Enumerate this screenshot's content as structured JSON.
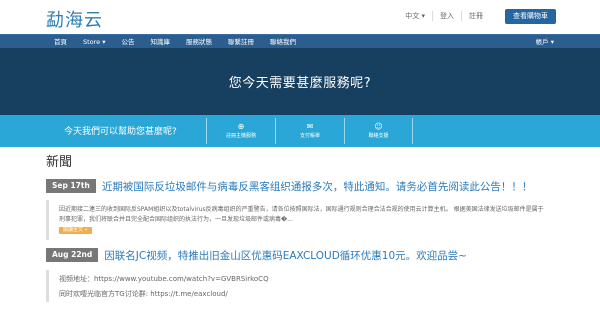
{
  "header": {
    "logo": "勐海云",
    "links": [
      "中文 ▾",
      "登入",
      "註冊"
    ],
    "cart_button": "查看購物車"
  },
  "nav": {
    "items": [
      "首頁",
      "Store ▾",
      "公告",
      "知識庫",
      "服務狀態",
      "聯繫註冊",
      "聯絡我們"
    ],
    "account": "帳戶 ▾"
  },
  "hero": {
    "title": "您今天需要甚麼服務呢?"
  },
  "helpbar": {
    "text": "今天我們可以幫助您甚麼呢?",
    "options": [
      {
        "icon": "globe-icon",
        "glyph": "⊕",
        "label": "註冊主機服務"
      },
      {
        "icon": "ticket-icon",
        "glyph": "✉",
        "label": "支付帳單"
      },
      {
        "icon": "support-icon",
        "glyph": "☺",
        "label": "聯絡支援"
      }
    ]
  },
  "news": {
    "section_title": "新聞",
    "items": [
      {
        "date": "Sep 17th",
        "title": "近期被国际反垃圾邮件与病毒反黑客组织通报多次，特此通知。请务必首先阅读此公告！！！",
        "body": "因近期接二連三的收到国际反SPAM組织以及totalvirus反病毒组织的严重警告，请各位按照国际法，国际通行规则合理合法合规的使用云计算主机。 根据美国法律发送垃圾邮件是属于刑事犯罪，我们将联合并且完全配合国际组织的执法行为，一旦发现垃圾邮件或病毒�...",
        "more": "閱讀全文 »"
      },
      {
        "date": "Aug 22nd",
        "title": "因联名JC视频，特推出旧金山区优惠码EAXCLOUD循环优惠10元。欢迎品尝~",
        "lines": [
          "视频地址：https://www.youtube.com/watch?v=GVBRSirkoCQ",
          "同时欢嘤光临官方TG讨论群: https://t.me/eaxcloud/"
        ]
      }
    ]
  }
}
